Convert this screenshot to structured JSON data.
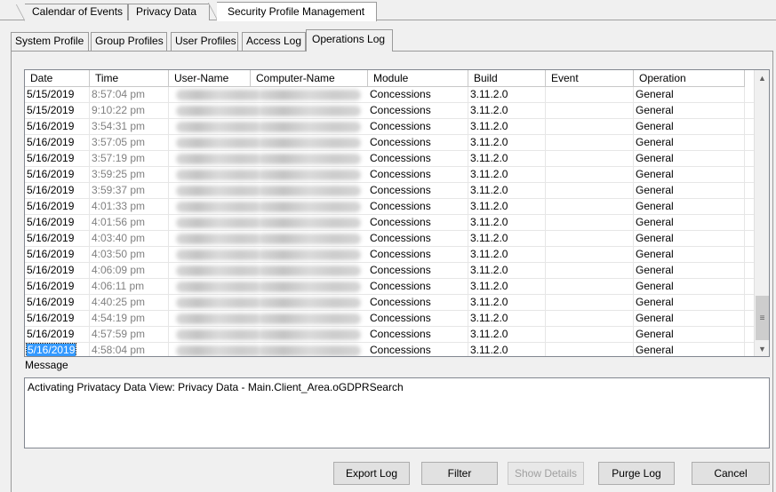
{
  "doc_tabs": [
    {
      "label": "Calendar of Events"
    },
    {
      "label": "Privacy Data"
    },
    {
      "label": "Security Profile Management"
    }
  ],
  "inner_tabs": [
    {
      "label": "System Profile"
    },
    {
      "label": "Group Profiles"
    },
    {
      "label": "User Profiles"
    },
    {
      "label": "Access Log"
    },
    {
      "label": "Operations Log"
    }
  ],
  "columns": [
    "Date",
    "Time",
    "User-Name",
    "Computer-Name",
    "Module",
    "Build",
    "Event",
    "Operation"
  ],
  "rows": [
    {
      "date": "5/15/2019",
      "time": "8:57:04 pm",
      "module": "Concessions",
      "build": "3.11.2.0",
      "event": "",
      "operation": "General"
    },
    {
      "date": "5/15/2019",
      "time": "9:10:22 pm",
      "module": "Concessions",
      "build": "3.11.2.0",
      "event": "",
      "operation": "General"
    },
    {
      "date": "5/16/2019",
      "time": "3:54:31 pm",
      "module": "Concessions",
      "build": "3.11.2.0",
      "event": "",
      "operation": "General"
    },
    {
      "date": "5/16/2019",
      "time": "3:57:05 pm",
      "module": "Concessions",
      "build": "3.11.2.0",
      "event": "",
      "operation": "General"
    },
    {
      "date": "5/16/2019",
      "time": "3:57:19 pm",
      "module": "Concessions",
      "build": "3.11.2.0",
      "event": "",
      "operation": "General"
    },
    {
      "date": "5/16/2019",
      "time": "3:59:25 pm",
      "module": "Concessions",
      "build": "3.11.2.0",
      "event": "",
      "operation": "General"
    },
    {
      "date": "5/16/2019",
      "time": "3:59:37 pm",
      "module": "Concessions",
      "build": "3.11.2.0",
      "event": "",
      "operation": "General"
    },
    {
      "date": "5/16/2019",
      "time": "4:01:33 pm",
      "module": "Concessions",
      "build": "3.11.2.0",
      "event": "",
      "operation": "General"
    },
    {
      "date": "5/16/2019",
      "time": "4:01:56 pm",
      "module": "Concessions",
      "build": "3.11.2.0",
      "event": "",
      "operation": "General"
    },
    {
      "date": "5/16/2019",
      "time": "4:03:40 pm",
      "module": "Concessions",
      "build": "3.11.2.0",
      "event": "",
      "operation": "General"
    },
    {
      "date": "5/16/2019",
      "time": "4:03:50 pm",
      "module": "Concessions",
      "build": "3.11.2.0",
      "event": "",
      "operation": "General"
    },
    {
      "date": "5/16/2019",
      "time": "4:06:09 pm",
      "module": "Concessions",
      "build": "3.11.2.0",
      "event": "",
      "operation": "General"
    },
    {
      "date": "5/16/2019",
      "time": "4:06:11 pm",
      "module": "Concessions",
      "build": "3.11.2.0",
      "event": "",
      "operation": "General"
    },
    {
      "date": "5/16/2019",
      "time": "4:40:25 pm",
      "module": "Concessions",
      "build": "3.11.2.0",
      "event": "",
      "operation": "General"
    },
    {
      "date": "5/16/2019",
      "time": "4:54:19 pm",
      "module": "Concessions",
      "build": "3.11.2.0",
      "event": "",
      "operation": "General"
    },
    {
      "date": "5/16/2019",
      "time": "4:57:59 pm",
      "module": "Concessions",
      "build": "3.11.2.0",
      "event": "",
      "operation": "General"
    },
    {
      "date": "5/16/2019",
      "time": "4:58:04 pm",
      "module": "Concessions",
      "build": "3.11.2.0",
      "event": "",
      "operation": "General"
    }
  ],
  "message": {
    "label": "Message",
    "text": "Activating Privatacy Data View: Privacy Data - Main.Client_Area.oGDPRSearch"
  },
  "buttons": {
    "export": "Export Log",
    "filter": "Filter",
    "show_details": "Show Details",
    "purge": "Purge Log",
    "cancel": "Cancel"
  },
  "scrollbar": {
    "up_glyph": "▲",
    "down_glyph": "▼",
    "thumb_glyph": "≡"
  },
  "colors": {
    "selection": "#3399ff",
    "time_text": "#808080"
  }
}
